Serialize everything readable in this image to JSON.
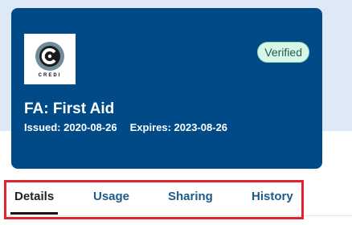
{
  "card": {
    "logo_text": "CREDI",
    "badge": "Verified",
    "title": "FA: First Aid",
    "issued": "Issued: 2020-08-26",
    "expires": "Expires: 2023-08-26"
  },
  "tabs": [
    {
      "label": "Details",
      "active": true
    },
    {
      "label": "Usage",
      "active": false
    },
    {
      "label": "Sharing",
      "active": false
    },
    {
      "label": "History",
      "active": false
    }
  ],
  "colors": {
    "card_bg": "#004b87",
    "badge_bg": "#d9f7e8",
    "highlight_border": "#e0232e",
    "tab_text": "#1d5a8a",
    "top_band": "#dde9f7"
  },
  "icons": {
    "logo": "credi-logo-icon"
  }
}
